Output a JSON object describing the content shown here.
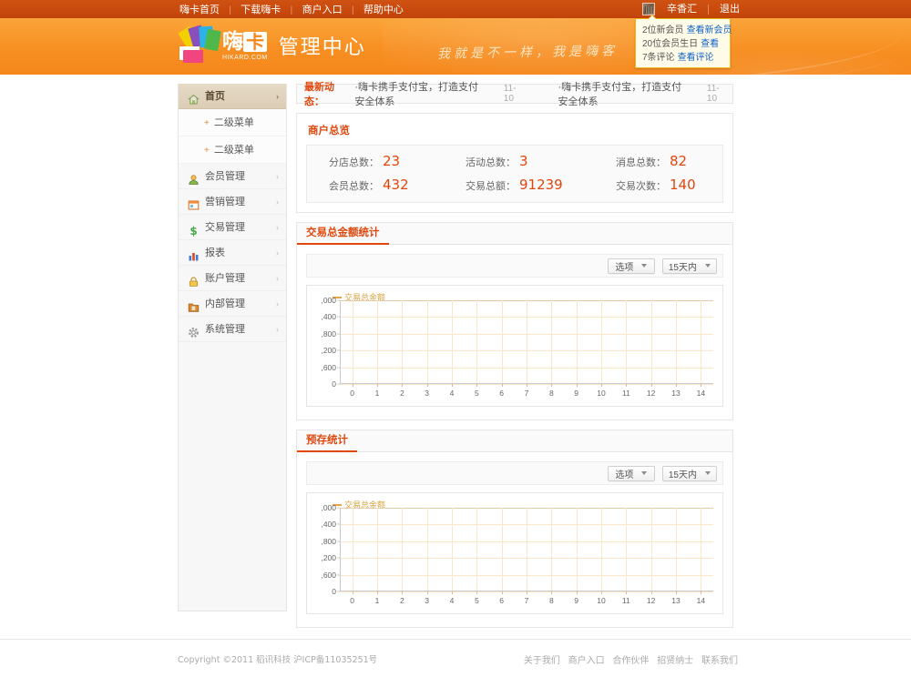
{
  "topnav": {
    "links": [
      "嗨卡首页",
      "下载嗨卡",
      "商户入口",
      "帮助中心"
    ],
    "separator": "|",
    "user": "辛香汇",
    "logout": "退出"
  },
  "notify": {
    "rows": [
      {
        "text": "2位新会员",
        "link": "查看新会员"
      },
      {
        "text": "20位会员生日",
        "link": "查看"
      },
      {
        "text": "7条评论",
        "link": "查看评论"
      }
    ]
  },
  "header": {
    "logo_char": "嗨",
    "logo_box": "卡",
    "logo_domain": "HIKARD.COM",
    "title": "管理中心",
    "slogan": "我就是不一样，我是嗨客"
  },
  "sidebar": {
    "items": [
      {
        "label": "首页",
        "icon": "home-icon",
        "active": true
      },
      {
        "label": "二级菜单",
        "icon": "plus-icon",
        "sub": true
      },
      {
        "label": "二级菜单",
        "icon": "plus-icon",
        "sub": true
      },
      {
        "label": "会员管理",
        "icon": "member-icon",
        "active": false
      },
      {
        "label": "营销管理",
        "icon": "campaign-icon",
        "active": false
      },
      {
        "label": "交易管理",
        "icon": "dollar-icon",
        "active": false
      },
      {
        "label": "报表",
        "icon": "chart-icon",
        "active": false
      },
      {
        "label": "账户管理",
        "icon": "lock-icon",
        "active": false
      },
      {
        "label": "内部管理",
        "icon": "folder-icon",
        "active": false
      },
      {
        "label": "系统管理",
        "icon": "gear-icon",
        "active": false
      }
    ],
    "arrow": "›",
    "plus": "+"
  },
  "news": {
    "label": "最新动态：",
    "items": [
      {
        "bullet": "·",
        "title": "嗨卡携手支付宝，打造支付安全体系",
        "date": "11-10"
      },
      {
        "bullet": "·",
        "title": "嗨卡携手支付宝，打造支付安全体系",
        "date": "11-10"
      }
    ]
  },
  "overview": {
    "title": "商户总览",
    "stats": [
      {
        "label": "分店总数：",
        "value": "23"
      },
      {
        "label": "活动总数：",
        "value": "3"
      },
      {
        "label": "消息总数：",
        "value": "82"
      },
      {
        "label": "会员总数：",
        "value": "432"
      },
      {
        "label": "交易总额：",
        "value": "91239"
      },
      {
        "label": "交易次数：",
        "value": "140"
      }
    ]
  },
  "panels": [
    {
      "tab": "交易总金额统计",
      "option_label": "选项",
      "range_label": "15天内"
    },
    {
      "tab": "预存统计",
      "option_label": "选项",
      "range_label": "15天内"
    }
  ],
  "chart_data": [
    {
      "type": "line",
      "title": "交易总金额统计",
      "legend": [
        "交易总金额"
      ],
      "legend_position": "top-left",
      "xlabel": "",
      "ylabel": "",
      "x": [
        0,
        1,
        2,
        3,
        4,
        5,
        6,
        7,
        8,
        9,
        10,
        11,
        12,
        13,
        14
      ],
      "xtick_labels": [
        "0",
        "1",
        "2",
        "3",
        "4",
        "5",
        "6",
        "7",
        "8",
        "9",
        "10",
        "11",
        "12",
        "13",
        "14"
      ],
      "ytick_labels": [
        ",000",
        ",400",
        ",800",
        ",200",
        ",600",
        "0"
      ],
      "ylim": [
        0,
        3000
      ],
      "grid": true,
      "series": [
        {
          "name": "交易总金额",
          "values": [
            0,
            0,
            0,
            0,
            0,
            0,
            0,
            0,
            0,
            0,
            0,
            0,
            0,
            0,
            0
          ],
          "color": "#e8a33d"
        }
      ]
    },
    {
      "type": "line",
      "title": "预存统计",
      "legend": [
        "交易总金额"
      ],
      "legend_position": "top-left",
      "xlabel": "",
      "ylabel": "",
      "x": [
        0,
        1,
        2,
        3,
        4,
        5,
        6,
        7,
        8,
        9,
        10,
        11,
        12,
        13,
        14
      ],
      "xtick_labels": [
        "0",
        "1",
        "2",
        "3",
        "4",
        "5",
        "6",
        "7",
        "8",
        "9",
        "10",
        "11",
        "12",
        "13",
        "14"
      ],
      "ytick_labels": [
        ",000",
        ",400",
        ",800",
        ",200",
        ",600",
        "0"
      ],
      "ylim": [
        0,
        3000
      ],
      "grid": true,
      "series": [
        {
          "name": "交易总金额",
          "values": [
            0,
            0,
            0,
            0,
            0,
            0,
            0,
            0,
            0,
            0,
            0,
            0,
            0,
            0,
            0
          ],
          "color": "#e8a33d"
        }
      ]
    }
  ],
  "footer": {
    "copyright": "Copyright ©2011 稻讯科技 沪ICP备11035251号",
    "links": [
      "关于我们",
      "商户入口",
      "合作伙伴",
      "招贤纳士",
      "联系我们"
    ]
  },
  "colors": {
    "topnav": "#c84a11",
    "header": "#f79226",
    "accent": "#e0470d",
    "active_nav": "#e0d2bd",
    "chart_line": "#e8a33d"
  }
}
